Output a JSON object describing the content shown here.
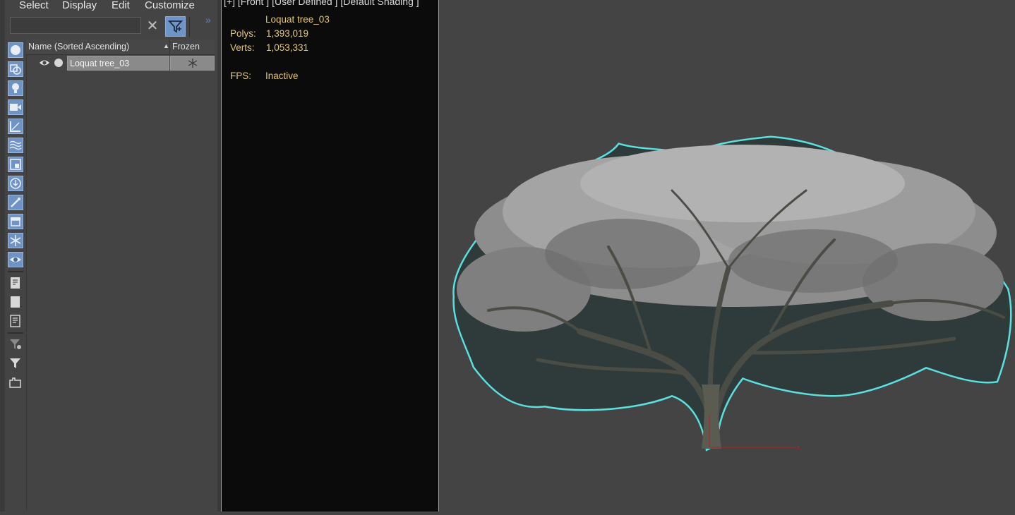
{
  "menu": {
    "select": "Select",
    "display": "Display",
    "edit": "Edit",
    "customize": "Customize"
  },
  "search": {
    "value": "",
    "placeholder": ""
  },
  "icons": {
    "clear": "close-icon",
    "filter": "filter-icon",
    "more": "double-chevron-right-icon"
  },
  "table": {
    "columns": [
      "Name (Sorted Ascending)",
      "Frozen"
    ],
    "rows": [
      {
        "name": "Loquat tree_03",
        "frozen_icon": "snowflake-icon"
      }
    ]
  },
  "viewport_left": {
    "label": "[+] [Front ] [User Defined ] [Default Shading ]",
    "object_name": "Loquat tree_03",
    "stats": {
      "polys_label": "Polys:",
      "polys_value": "1,393,019",
      "verts_label": "Verts:",
      "verts_value": "1,053,331",
      "fps_label": "FPS:",
      "fps_value": "Inactive"
    }
  },
  "viewport_right": {
    "object": "tree-model",
    "axis_label": "x"
  },
  "colors": {
    "panel_bg": "#444444",
    "active_border": "#c9a227",
    "stats_text": "#e7c766",
    "selection_outline": "#5ef2f2",
    "toolbar_active": "#6f93c5"
  }
}
